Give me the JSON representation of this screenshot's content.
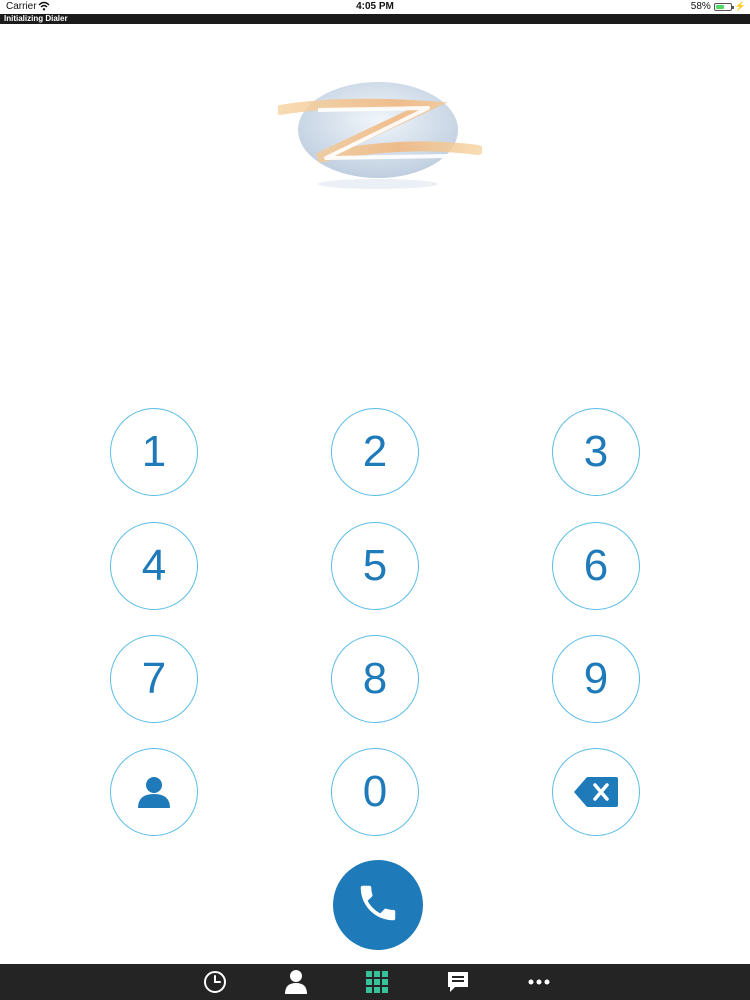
{
  "status_bar": {
    "carrier": "Carrier",
    "time": "4:05 PM",
    "battery": "58%",
    "battery_level": 0.58,
    "icons": [
      "wifi-icon",
      "battery-icon",
      "charging-icon"
    ]
  },
  "banner": {
    "text": "Initializing Dialer"
  },
  "logo": {
    "name": "z-logo"
  },
  "keypad": {
    "keys": [
      "1",
      "2",
      "3",
      "4",
      "5",
      "6",
      "7",
      "8",
      "9",
      "",
      "0",
      ""
    ],
    "contact_icon": "person-icon",
    "backspace_icon": "backspace-icon"
  },
  "call_button": {
    "icon": "phone-icon",
    "color": "#1e7ab8"
  },
  "tab_bar": {
    "tabs": [
      "history-icon",
      "contacts-icon",
      "keypad-icon",
      "messages-icon",
      "more-icon"
    ],
    "active": "keypad-icon",
    "active_color": "#37c29a"
  },
  "colors": {
    "accent": "#1e7ab8",
    "key_border": "#5bbde6",
    "tab_bar_bg": "#242424",
    "banner_bg": "#1b1b1b"
  }
}
